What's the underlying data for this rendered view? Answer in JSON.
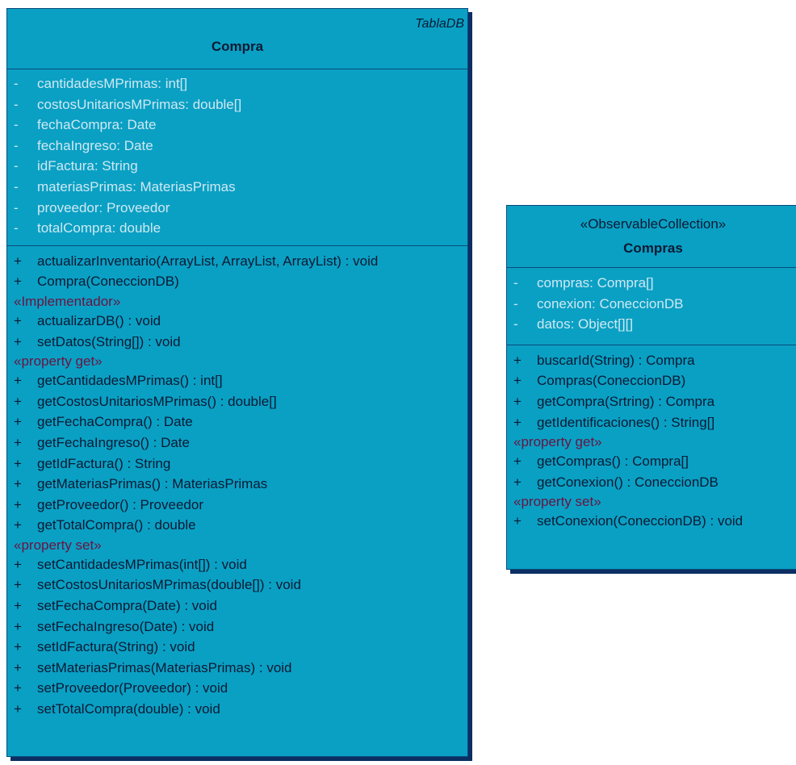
{
  "compra": {
    "stereotype": "TablaDB",
    "name": "Compra",
    "attributes": [
      {
        "vis": "-",
        "text": "cantidadesMPrimas: int[]"
      },
      {
        "vis": "-",
        "text": "costosUnitariosMPrimas: double[]"
      },
      {
        "vis": "-",
        "text": "fechaCompra: Date"
      },
      {
        "vis": "-",
        "text": "fechaIngreso: Date"
      },
      {
        "vis": "-",
        "text": "idFactura: String"
      },
      {
        "vis": "-",
        "text": "materiasPrimas: MateriasPrimas"
      },
      {
        "vis": "-",
        "text": "proveedor: Proveedor"
      },
      {
        "vis": "-",
        "text": "totalCompra: double"
      }
    ],
    "operations": [
      {
        "vis": "+",
        "text": "actualizarInventario(ArrayList, ArrayList, ArrayList) : void"
      },
      {
        "vis": "+",
        "text": "Compra(ConeccionDB)"
      }
    ],
    "groups": [
      {
        "label": "«Implementador»",
        "operations": [
          {
            "vis": "+",
            "text": "actualizarDB() : void"
          },
          {
            "vis": "+",
            "text": "setDatos(String[]) : void"
          }
        ]
      },
      {
        "label": "«property get»",
        "operations": [
          {
            "vis": "+",
            "text": "getCantidadesMPrimas() : int[]"
          },
          {
            "vis": "+",
            "text": "getCostosUnitariosMPrimas() : double[]"
          },
          {
            "vis": "+",
            "text": "getFechaCompra() : Date"
          },
          {
            "vis": "+",
            "text": "getFechaIngreso() : Date"
          },
          {
            "vis": "+",
            "text": "getIdFactura() : String"
          },
          {
            "vis": "+",
            "text": "getMateriasPrimas() : MateriasPrimas"
          },
          {
            "vis": "+",
            "text": "getProveedor() : Proveedor"
          },
          {
            "vis": "+",
            "text": "getTotalCompra() : double"
          }
        ]
      },
      {
        "label": "«property set»",
        "operations": [
          {
            "vis": "+",
            "text": "setCantidadesMPrimas(int[]) : void"
          },
          {
            "vis": "+",
            "text": "setCostosUnitariosMPrimas(double[]) : void"
          },
          {
            "vis": "+",
            "text": "setFechaCompra(Date) : void"
          },
          {
            "vis": "+",
            "text": "setFechaIngreso(Date) : void"
          },
          {
            "vis": "+",
            "text": "setIdFactura(String) : void"
          },
          {
            "vis": "+",
            "text": "setMateriasPrimas(MateriasPrimas) : void"
          },
          {
            "vis": "+",
            "text": "setProveedor(Proveedor) : void"
          },
          {
            "vis": "+",
            "text": "setTotalCompra(double) : void"
          }
        ]
      }
    ]
  },
  "compras": {
    "stereotype": "«ObservableCollection»",
    "name": "Compras",
    "attributes": [
      {
        "vis": "-",
        "text": "compras: Compra[]"
      },
      {
        "vis": "-",
        "text": "conexion: ConeccionDB"
      },
      {
        "vis": "-",
        "text": "datos: Object[][]"
      }
    ],
    "operations": [
      {
        "vis": "+",
        "text": "buscarId(String) : Compra"
      },
      {
        "vis": "+",
        "text": "Compras(ConeccionDB)"
      },
      {
        "vis": "+",
        "text": "getCompra(Srtring) : Compra"
      },
      {
        "vis": "+",
        "text": "getIdentificaciones() : String[]"
      }
    ],
    "groups": [
      {
        "label": "«property get»",
        "operations": [
          {
            "vis": "+",
            "text": "getCompras() : Compra[]"
          },
          {
            "vis": "+",
            "text": "getConexion() : ConeccionDB"
          }
        ]
      },
      {
        "label": "«property set»",
        "operations": [
          {
            "vis": "+",
            "text": "setConexion(ConeccionDB) : void"
          }
        ]
      }
    ]
  },
  "colors": {
    "class_fill": "#0aa0c4",
    "class_border": "#0a4a7a",
    "shadow": "#0b2e63",
    "attribute_text": "#cfe8f2",
    "operation_text": "#0a1a33",
    "stereotype_group_text": "#6a1340"
  }
}
